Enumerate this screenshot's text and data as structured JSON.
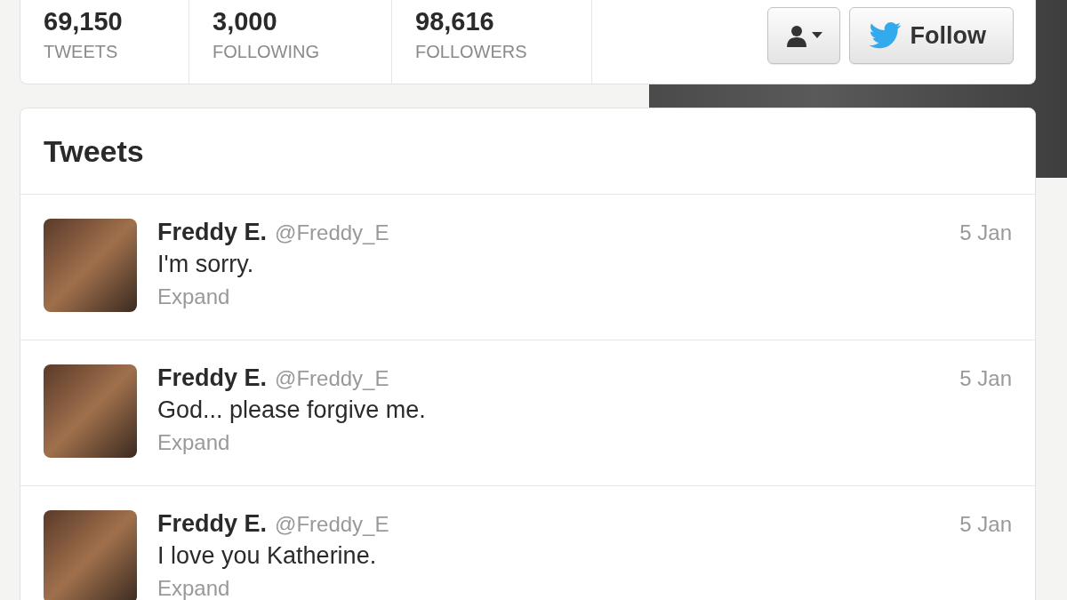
{
  "profile_stats": [
    {
      "value": "69,150",
      "label": "TWEETS"
    },
    {
      "value": "3,000",
      "label": "FOLLOWING"
    },
    {
      "value": "98,616",
      "label": "FOLLOWERS"
    }
  ],
  "actions": {
    "follow_label": "Follow"
  },
  "timeline": {
    "title": "Tweets",
    "tweets": [
      {
        "name": "Freddy E.",
        "handle": "@Freddy_E",
        "text": "I'm sorry.",
        "action": "Expand",
        "date": "5 Jan"
      },
      {
        "name": "Freddy E.",
        "handle": "@Freddy_E",
        "text": "God... please forgive me.",
        "action": "Expand",
        "date": "5 Jan"
      },
      {
        "name": "Freddy E.",
        "handle": "@Freddy_E",
        "text": "I love you Katherine.",
        "action": "Expand",
        "date": "5 Jan"
      }
    ]
  }
}
